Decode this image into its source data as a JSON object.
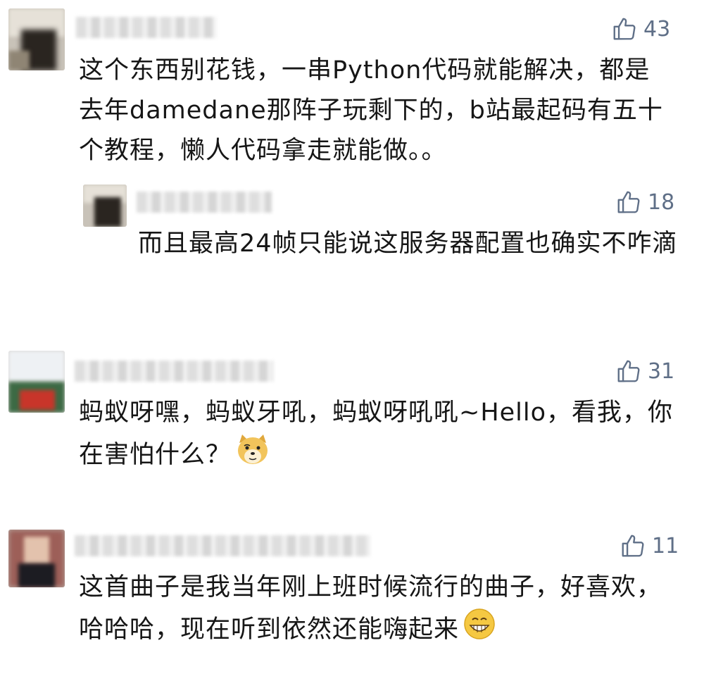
{
  "comments": [
    {
      "likes": "43",
      "text": "这个东西别花钱，一串Python代码就能解决，都是去年damedane那阵子玩剩下的，b站最起码有五十个教程，懒人代码拿走就能做。。",
      "reply": {
        "likes": "18",
        "text": "而且最高24帧只能说这服务器配置也确实不咋滴"
      }
    },
    {
      "likes": "31",
      "text": "蚂蚁呀嘿，蚂蚁牙吼，蚂蚁呀吼吼~Hello，看我，你在害怕什么？",
      "emoji": "doge-icon"
    },
    {
      "likes": "11",
      "text": "这首曲子是我当年刚上班时候流行的曲子，好喜欢，哈哈哈，现在听到依然还能嗨起来",
      "emoji": "grin-icon"
    }
  ],
  "colors": {
    "like": "#5f6f87",
    "text": "#161616"
  }
}
